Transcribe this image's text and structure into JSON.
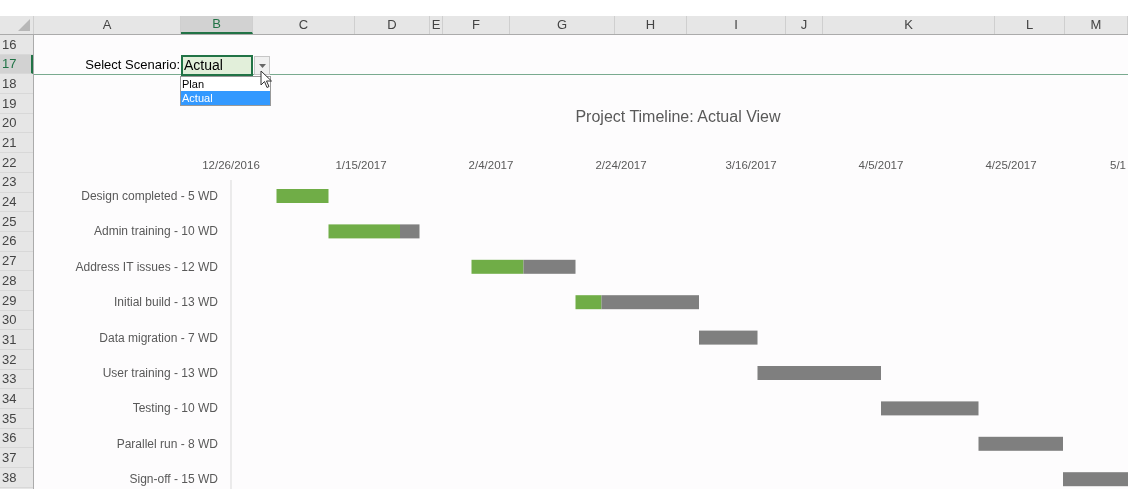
{
  "columns": [
    {
      "label": "A",
      "selected": false
    },
    {
      "label": "B",
      "selected": true
    },
    {
      "label": "C",
      "selected": false
    },
    {
      "label": "D",
      "selected": false
    },
    {
      "label": "E",
      "selected": false
    },
    {
      "label": "F",
      "selected": false
    },
    {
      "label": "G",
      "selected": false
    },
    {
      "label": "H",
      "selected": false
    },
    {
      "label": "I",
      "selected": false
    },
    {
      "label": "J",
      "selected": false
    },
    {
      "label": "K",
      "selected": false
    },
    {
      "label": "L",
      "selected": false
    },
    {
      "label": "M",
      "selected": false
    }
  ],
  "rows": [
    {
      "label": "16",
      "selected": false
    },
    {
      "label": "17",
      "selected": true
    },
    {
      "label": "18",
      "selected": false
    },
    {
      "label": "19",
      "selected": false
    },
    {
      "label": "20",
      "selected": false
    },
    {
      "label": "21",
      "selected": false
    },
    {
      "label": "22",
      "selected": false
    },
    {
      "label": "23",
      "selected": false
    },
    {
      "label": "24",
      "selected": false
    },
    {
      "label": "25",
      "selected": false
    },
    {
      "label": "26",
      "selected": false
    },
    {
      "label": "27",
      "selected": false
    },
    {
      "label": "28",
      "selected": false
    },
    {
      "label": "29",
      "selected": false
    },
    {
      "label": "30",
      "selected": false
    },
    {
      "label": "31",
      "selected": false
    },
    {
      "label": "32",
      "selected": false
    },
    {
      "label": "33",
      "selected": false
    },
    {
      "label": "34",
      "selected": false
    },
    {
      "label": "35",
      "selected": false
    },
    {
      "label": "36",
      "selected": false
    },
    {
      "label": "37",
      "selected": false
    },
    {
      "label": "38",
      "selected": false
    }
  ],
  "scenario": {
    "label": "Select Scenario:",
    "value": "Actual",
    "options": [
      {
        "label": "Plan",
        "selected": false
      },
      {
        "label": "Actual",
        "selected": true
      }
    ]
  },
  "timeline": {
    "title": "Project Timeline: Actual View",
    "date_labels": [
      "12/26/2016",
      "1/15/2017",
      "2/4/2017",
      "2/24/2017",
      "3/16/2017",
      "4/5/2017",
      "4/25/2017",
      "5/1"
    ],
    "tasks": [
      {
        "label": "Design completed - 5 WD"
      },
      {
        "label": "Admin training - 10 WD"
      },
      {
        "label": "Address IT issues - 12 WD"
      },
      {
        "label": "Initial build - 13 WD"
      },
      {
        "label": "Data migration - 7 WD"
      },
      {
        "label": "User training - 13 WD"
      },
      {
        "label": "Testing - 10 WD"
      },
      {
        "label": "Parallel run - 8 WD"
      },
      {
        "label": "Sign-off - 15 WD"
      }
    ]
  }
}
